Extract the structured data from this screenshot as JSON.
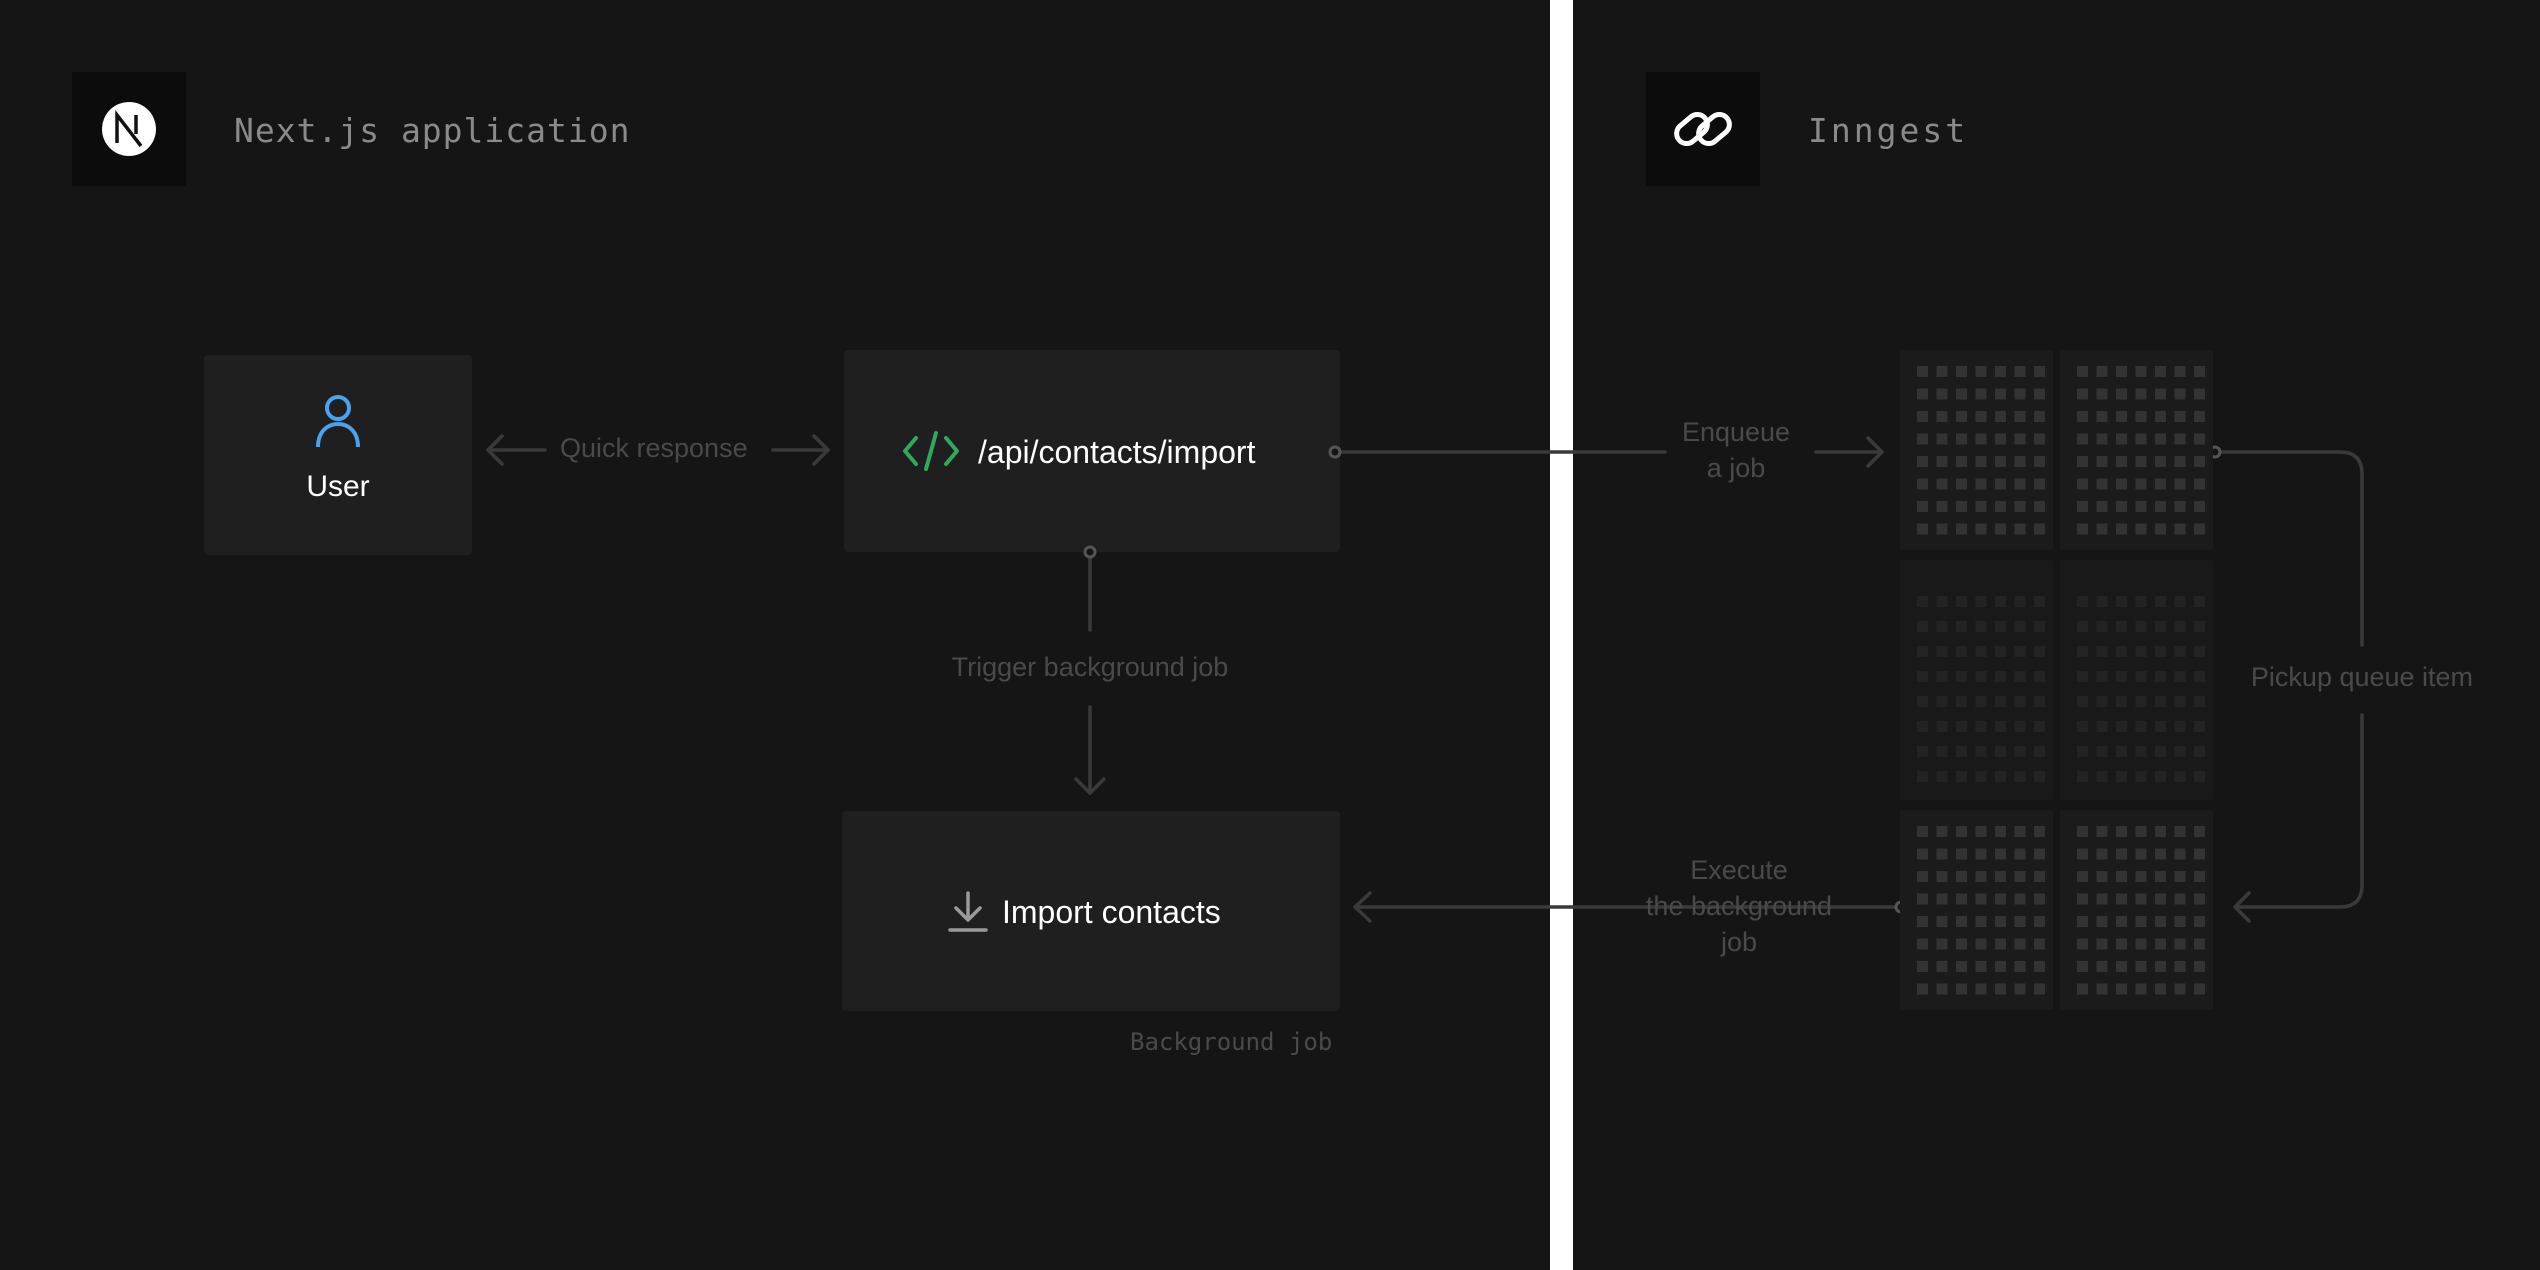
{
  "left": {
    "title": "Next.js application",
    "logo_icon": "nextjs-logo-icon",
    "user_label": "User",
    "endpoint_label": "/api/contacts/import",
    "quick_response_label": "Quick response",
    "trigger_label": "Trigger background job",
    "import_label": "Import contacts",
    "background_job_caption": "Background job"
  },
  "right": {
    "title": "Inngest",
    "logo_icon": "inngest-logo-icon",
    "enqueue_label": "Enqueue\na job",
    "pickup_label": "Pickup queue item",
    "execute_label": "Execute\nthe background\njob"
  },
  "colors": {
    "background": "#151515",
    "divider": "#ffffff",
    "card": "#1f1f1f",
    "user_icon": "#4aa3f0",
    "code_icon": "#2eaa5e",
    "connector": "#3a3a3a",
    "label_text": "#4a4a4a"
  }
}
